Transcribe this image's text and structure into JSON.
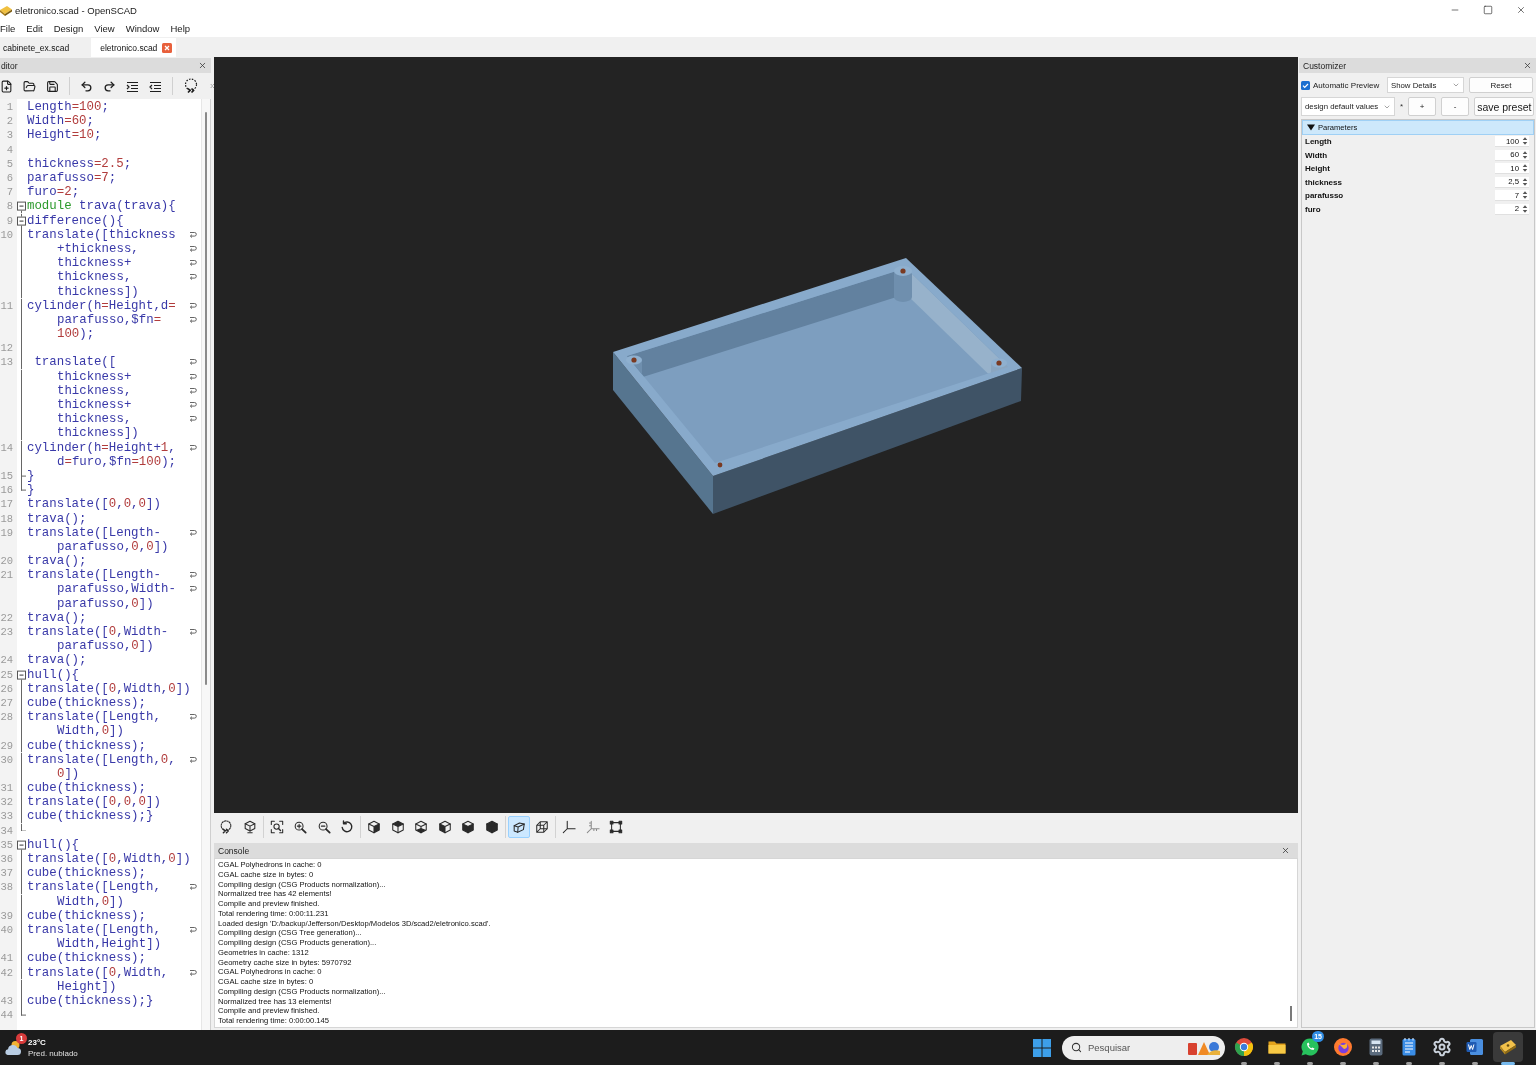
{
  "window": {
    "title": "eletronico.scad - OpenSCAD"
  },
  "menu": [
    "File",
    "Edit",
    "Design",
    "View",
    "Window",
    "Help"
  ],
  "file_tabs": [
    {
      "label": "cabinete_ex.scad",
      "selected": false
    },
    {
      "label": "eletronico.scad",
      "selected": true
    }
  ],
  "editor": {
    "title": "ditor",
    "lines": [
      {
        "number": "1",
        "rows": [
          "Length=100;"
        ]
      },
      {
        "number": "2",
        "rows": [
          "Width=60;"
        ]
      },
      {
        "number": "3",
        "rows": [
          "Height=10;"
        ]
      },
      {
        "number": "4"
      },
      {
        "number": "5",
        "rows": [
          "thickness=2.5;"
        ]
      },
      {
        "number": "6",
        "rows": [
          "parafusso=7;"
        ]
      },
      {
        "number": "7",
        "rows": [
          "furo=2;"
        ]
      },
      {
        "number": "8",
        "kind": "start",
        "keyword": "module",
        "rows": [
          " trava(trava){"
        ]
      },
      {
        "number": "9",
        "kind": "nested",
        "rows": [
          "difference(){"
        ]
      },
      {
        "number": "10",
        "kind": "inside",
        "rows": [
          "translate([thickness",
          "+thickness,",
          "thickness+",
          "thickness,",
          "thickness])"
        ]
      },
      {
        "number": "11",
        "kind": "inside",
        "rows": [
          "cylinder(h=Height,d=",
          "parafusso,$fn=",
          "100);"
        ]
      },
      {
        "number": "12",
        "kind": "inside"
      },
      {
        "number": "13",
        "kind": "inside",
        "rows": [
          " translate([",
          "thickness+",
          "thickness,",
          "thickness+",
          "thickness,",
          "thickness])"
        ]
      },
      {
        "number": "14",
        "kind": "inside",
        "rows": [
          "cylinder(h=Height+1,",
          "d=furo,$fn=100);"
        ]
      },
      {
        "number": "15",
        "kind": "branch",
        "rows": [
          "}"
        ]
      },
      {
        "number": "16",
        "kind": "end",
        "rows": [
          "}"
        ]
      },
      {
        "number": "17",
        "rows": [
          "translate([0,0,0])"
        ]
      },
      {
        "number": "18",
        "rows": [
          "trava();"
        ]
      },
      {
        "number": "19",
        "rows": [
          "translate([Length-",
          "parafusso,0,0])"
        ]
      },
      {
        "number": "20",
        "rows": [
          "trava();"
        ]
      },
      {
        "number": "21",
        "rows": [
          "translate([Length-",
          "parafusso,Width-",
          "parafusso,0])"
        ]
      },
      {
        "number": "22",
        "rows": [
          "trava();"
        ]
      },
      {
        "number": "23",
        "rows": [
          "translate([0,Width-",
          "parafusso,0])"
        ]
      },
      {
        "number": "24",
        "rows": [
          "trava();"
        ]
      },
      {
        "number": "25",
        "kind": "start",
        "rows": [
          "hull(){"
        ]
      },
      {
        "number": "26",
        "kind": "inside",
        "rows": [
          "translate([0,Width,0])"
        ]
      },
      {
        "number": "27",
        "kind": "inside",
        "rows": [
          "cube(thickness);"
        ]
      },
      {
        "number": "28",
        "kind": "inside",
        "rows": [
          "translate([Length,",
          "Width,0])"
        ]
      },
      {
        "number": "29",
        "kind": "inside",
        "rows": [
          "cube(thickness);"
        ]
      },
      {
        "number": "30",
        "kind": "inside",
        "rows": [
          "translate([Length,0,",
          "0])"
        ]
      },
      {
        "number": "31",
        "kind": "inside",
        "rows": [
          "cube(thickness);"
        ]
      },
      {
        "number": "32",
        "kind": "inside",
        "rows": [
          "translate([0,0,0])"
        ]
      },
      {
        "number": "33",
        "kind": "inside",
        "rows": [
          "cube(thickness);}"
        ]
      },
      {
        "number": "34",
        "kind": "end"
      },
      {
        "number": "35",
        "kind": "start",
        "rows": [
          "hull(){"
        ]
      },
      {
        "number": "36",
        "kind": "inside",
        "rows": [
          "translate([0,Width,0])"
        ]
      },
      {
        "number": "37",
        "kind": "inside",
        "rows": [
          "cube(thickness);"
        ]
      },
      {
        "number": "38",
        "kind": "inside",
        "rows": [
          "translate([Length,",
          "Width,0])"
        ]
      },
      {
        "number": "39",
        "kind": "inside",
        "rows": [
          "cube(thickness);"
        ]
      },
      {
        "number": "40",
        "kind": "inside",
        "rows": [
          "translate([Length,",
          "Width,Height])"
        ]
      },
      {
        "number": "41",
        "kind": "inside",
        "rows": [
          "cube(thickness);"
        ]
      },
      {
        "number": "42",
        "kind": "inside",
        "rows": [
          "translate([0,Width,",
          "Height])"
        ]
      },
      {
        "number": "43",
        "kind": "inside",
        "rows": [
          "cube(thickness);}"
        ]
      },
      {
        "number": "44",
        "kind": "end"
      }
    ]
  },
  "view_toolbar": [
    {
      "buttons": [
        {
          "kind": "preview",
          "selected": false
        },
        {
          "kind": "render",
          "selected": false
        }
      ]
    },
    {
      "buttons": [
        {
          "kind": "view-all",
          "selected": false
        },
        {
          "kind": "zoom-in",
          "selected": false
        },
        {
          "kind": "zoom-out",
          "selected": false
        },
        {
          "kind": "reset-view",
          "selected": false
        }
      ]
    },
    {
      "buttons": [
        {
          "kind": "view-right",
          "selected": false
        },
        {
          "kind": "view-top",
          "selected": false
        },
        {
          "kind": "view-bottom",
          "selected": false
        },
        {
          "kind": "view-left",
          "selected": false
        },
        {
          "kind": "view-front",
          "selected": false
        },
        {
          "kind": "view-back",
          "selected": false
        }
      ]
    },
    {
      "buttons": [
        {
          "kind": "perspective",
          "selected": true
        },
        {
          "kind": "orthogonal",
          "selected": false
        }
      ]
    },
    {
      "buttons": [
        {
          "kind": "axes",
          "selected": false
        },
        {
          "kind": "scale-markers",
          "selected": false
        },
        {
          "kind": "edges",
          "selected": false
        }
      ]
    }
  ],
  "console": {
    "title": "Console",
    "lines": [
      "CGAL Polyhedrons in cache: 0",
      "CGAL cache size in bytes: 0",
      "Compiling design (CSG Products normalization)...",
      "Normalized tree has 42 elements!",
      "Compile and preview finished.",
      "Total rendering time: 0:00:11.231",
      "Loaded design 'D:/backup/Jefferson/Desktop/Modelos 3D/scad2/eletronico.scad'.",
      "Compiling design (CSG Tree generation)...",
      "Compiling design (CSG Products generation)...",
      "Geometries in cache: 1312",
      "Geometry cache size in bytes: 5970792",
      "CGAL Polyhedrons in cache: 0",
      "CGAL cache size in bytes: 0",
      "Compiling design (CSG Products normalization)...",
      "Normalized tree has 13 elements!",
      "Compile and preview finished.",
      "Total rendering time: 0:00:00.145"
    ]
  },
  "customizer": {
    "title": "Customizer",
    "auto_preview": {
      "label": "Automatic Preview",
      "checked": true
    },
    "details_select": "Show Details",
    "reset_button": "Reset",
    "preset_select": "design default values",
    "modified_mark": "*",
    "add_button": "+",
    "remove_button": "-",
    "save_button": "save preset",
    "parameters": {
      "title": "Parameters",
      "expanded": true,
      "items": [
        {
          "name": "Length",
          "value": "100"
        },
        {
          "name": "Width",
          "value": "60"
        },
        {
          "name": "Height",
          "value": "10"
        },
        {
          "name": "thickness",
          "value": "2,5"
        },
        {
          "name": "parafusso",
          "value": "7"
        },
        {
          "name": "furo",
          "value": "2"
        }
      ]
    }
  },
  "taskbar": {
    "weather": {
      "badge": "1",
      "temperature": "23°C",
      "forecast": "Pred. nublado"
    },
    "search": {
      "placeholder": "Pesquisar"
    },
    "apps": [
      {
        "kind": "browser",
        "running": true,
        "selected": false
      },
      {
        "kind": "files",
        "running": true,
        "selected": false
      },
      {
        "kind": "chat",
        "badge": "15",
        "running": true,
        "selected": false
      },
      {
        "kind": "fox-browser",
        "running": true,
        "selected": false
      },
      {
        "kind": "calculator",
        "running": true,
        "selected": false
      },
      {
        "kind": "notepad",
        "running": true,
        "selected": false
      },
      {
        "kind": "settings",
        "running": true,
        "selected": false
      },
      {
        "kind": "word",
        "running": true,
        "selected": false
      },
      {
        "kind": "openscad",
        "running": true,
        "selected": true
      }
    ]
  }
}
